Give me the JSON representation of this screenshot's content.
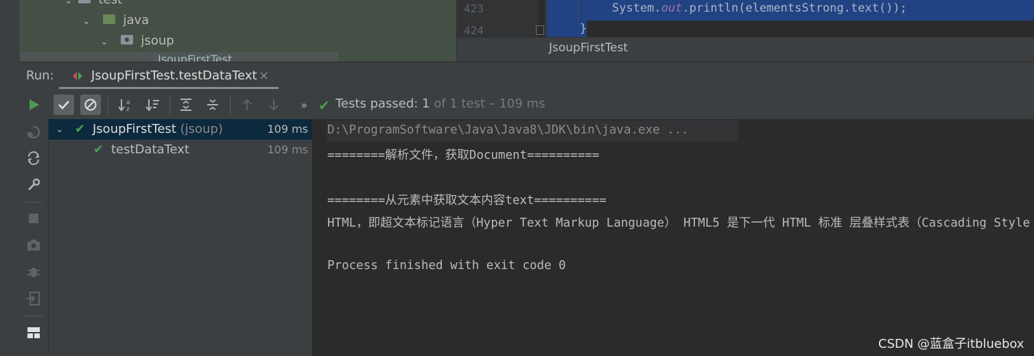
{
  "project_tree": {
    "items": [
      {
        "label": "test"
      },
      {
        "label": "java"
      },
      {
        "label": "jsoup"
      },
      {
        "label": "JsoupFirstTest"
      }
    ]
  },
  "editor": {
    "line_numbers": [
      "423",
      "424"
    ],
    "code_line_1": {
      "prefix": "System.",
      "field": "out",
      "rest": ".println(elementsStrong.text());"
    },
    "code_line_2": "}",
    "tab_label": "JsoupFirstTest"
  },
  "run_window": {
    "label": "Run:",
    "tab_title": "JsoupFirstTest.testDataText",
    "close_glyph": "×"
  },
  "toolbar": {
    "buttons": [
      "rerun-icon",
      "show-passed-icon",
      "show-ignored-icon",
      "sort-alpha-icon",
      "sort-duration-icon",
      "expand-all-icon",
      "collapse-all-icon",
      "previous-test-icon",
      "next-test-icon",
      "more-icon"
    ],
    "more_glyph": "»",
    "status": {
      "prefix": "Tests passed: ",
      "passed": "1",
      "suffix": " of 1 test – 109 ms"
    }
  },
  "test_tree": {
    "rows": [
      {
        "name": "JsoupFirstTest",
        "package": " (jsoup)",
        "time": "109 ms"
      },
      {
        "name": "testDataText",
        "time": "109 ms"
      }
    ]
  },
  "console": {
    "lines": [
      "D:\\ProgramSoftware\\Java\\Java8\\JDK\\bin\\java.exe ...",
      "========解析文件，获取Document==========",
      "",
      "========从元素中获取文本内容text==========",
      "HTML，即超文本标记语言（Hyper Text Markup Language） HTML5 是下一代 HTML 标准 层叠样式表（Cascading Style Sheets）",
      "",
      "Process finished with exit code 0"
    ]
  },
  "watermark": "CSDN @蓝盒子itbluebox",
  "colors": {
    "success_green": "#499c54",
    "selection_blue": "#214283",
    "panel_bg": "#3c3f41",
    "console_bg": "#2b2b2b"
  }
}
